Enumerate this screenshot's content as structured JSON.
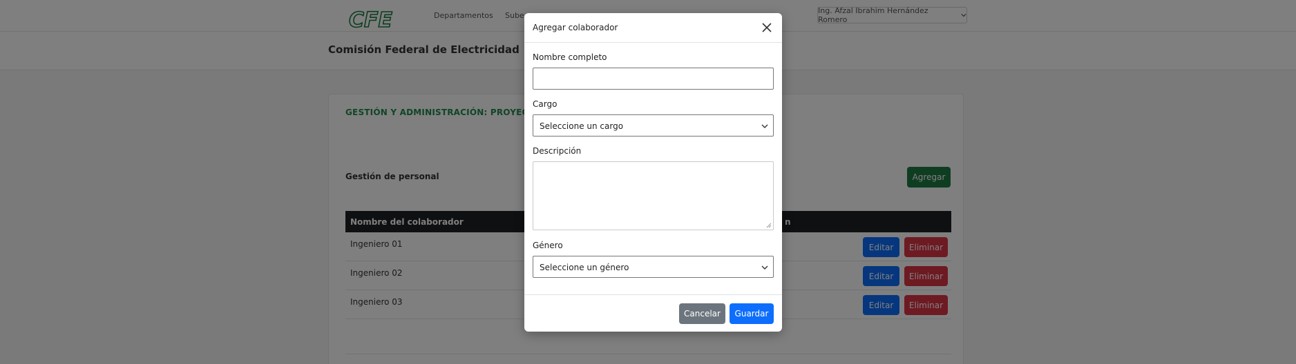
{
  "nav": {
    "logo_text": "CFE",
    "links": [
      "Departamentos",
      "Sube"
    ],
    "user": "Ing. Afzal Ibrahim Hernández Romero"
  },
  "subheader": {
    "org_title": "Comisión Federal de Electricidad | Divisió"
  },
  "card": {
    "section_title": "GESTIÓN Y ADMINISTRACIÓN: PROYECTOS Y",
    "staff_title": "Gestión de personal",
    "add_label": "Agregar",
    "table": {
      "columns": [
        "Nombre del colaborador",
        "n"
      ],
      "rows": [
        {
          "name": "Ingeniero 01"
        },
        {
          "name": "Ingeniero 02"
        },
        {
          "name": "Ingeniero 03"
        }
      ],
      "edit_label": "Editar",
      "delete_label": "Eliminar"
    }
  },
  "modal": {
    "title": "Agregar colaborador",
    "fields": {
      "name_label": "Nombre completo",
      "name_value": "",
      "role_label": "Cargo",
      "role_value": "Seleccione un cargo",
      "desc_label": "Descripción",
      "desc_value": "",
      "gender_label": "Género",
      "gender_value": "Seleccione un género"
    },
    "cancel_label": "Cancelar",
    "save_label": "Guardar"
  },
  "colors": {
    "brand_green": "#1e8a4c",
    "primary": "#0d6efd",
    "danger": "#dc3545",
    "secondary": "#6c757d"
  }
}
